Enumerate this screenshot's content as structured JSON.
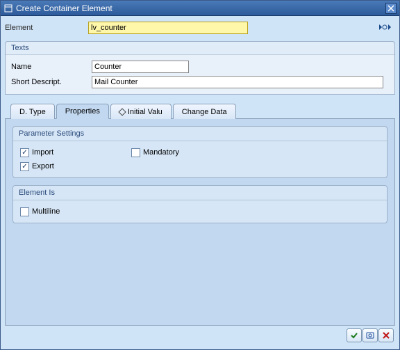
{
  "dialog": {
    "title": "Create Container Element"
  },
  "element": {
    "label": "Element",
    "value": "lv_counter"
  },
  "texts": {
    "header": "Texts",
    "name_label": "Name",
    "name_value": "Counter",
    "shortdesc_label": "Short Descript.",
    "shortdesc_value": "Mail Counter"
  },
  "tabs": {
    "dtype": "D. Type",
    "properties": "Properties",
    "initial": "Initial Valu",
    "changedata": "Change Data"
  },
  "param_settings": {
    "header": "Parameter Settings",
    "import_label": "Import",
    "export_label": "Export",
    "mandatory_label": "Mandatory",
    "import_checked": true,
    "export_checked": true,
    "mandatory_checked": false
  },
  "element_is": {
    "header": "Element Is",
    "multiline_label": "Multiline",
    "multiline_checked": false
  },
  "icons": {
    "check": "✓",
    "close": "✕",
    "nav": "▸▹▸"
  }
}
